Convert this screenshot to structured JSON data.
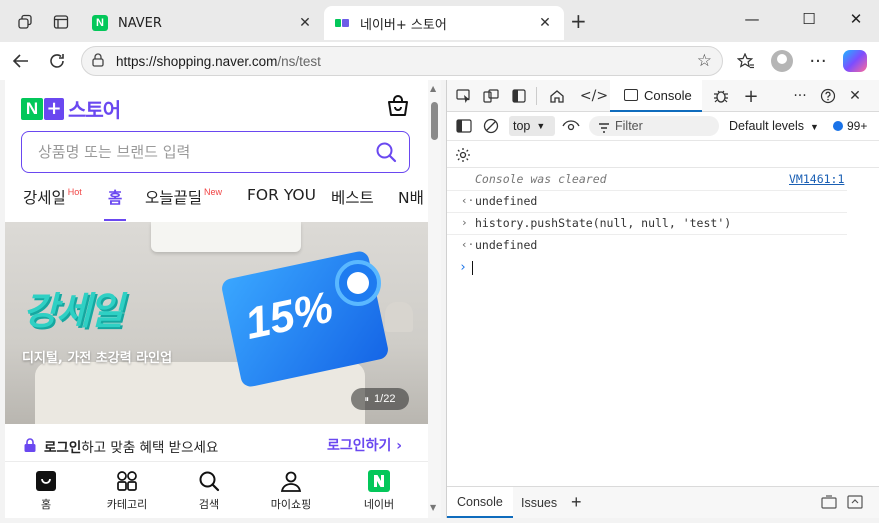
{
  "browser": {
    "tabs": [
      {
        "title": "NAVER",
        "active": false
      },
      {
        "title": "네이버+ 스토어",
        "active": true
      }
    ],
    "new_tab": "+",
    "url_host": "https://shopping.naver.com",
    "url_path": "/ns/test",
    "window_controls": {
      "minimize": "—",
      "maximize": "☐",
      "close": "✕"
    }
  },
  "store": {
    "logo_n": "N",
    "logo_plus": "+",
    "logo_text": "스토어",
    "search_placeholder": "상품명 또는 브랜드 입력",
    "nav": [
      {
        "label": "강세일",
        "badge": "Hot"
      },
      {
        "label": "홈",
        "badge": ""
      },
      {
        "label": "오늘끝딜",
        "badge": "New"
      },
      {
        "label": "FOR YOU",
        "badge": ""
      },
      {
        "label": "베스트",
        "badge": ""
      },
      {
        "label": "N배",
        "badge": ""
      }
    ],
    "banner": {
      "headline": "강세일",
      "subtitle": "디지털, 가전 초강력 라인업",
      "discount": "15%",
      "pager_icon": "⏸",
      "pager": "1/22"
    },
    "login": {
      "message_bold": "로그인",
      "message_rest": "하고 맞춤 혜택 받으세요",
      "cta": "로그인하기 ›"
    },
    "bottom_nav": [
      {
        "label": "홈",
        "icon": "bag-icon"
      },
      {
        "label": "카테고리",
        "icon": "grid-icon"
      },
      {
        "label": "검색",
        "icon": "search-icon"
      },
      {
        "label": "마이쇼핑",
        "icon": "person-icon"
      },
      {
        "label": "네이버",
        "icon": "naver-icon"
      }
    ]
  },
  "devtools": {
    "console_tab": "Console",
    "context": "top",
    "filter_placeholder": "Filter",
    "levels": "Default levels",
    "issues_count": "99+",
    "lines": [
      {
        "arrow": "",
        "text": "Console was cleared",
        "source": "VM1461:1",
        "kind": "info"
      },
      {
        "arrow": "‹·",
        "text": "undefined",
        "source": "",
        "kind": "result"
      },
      {
        "arrow": "›",
        "text": "history.pushState(null, null, 'test')",
        "source": "",
        "kind": "input"
      },
      {
        "arrow": "‹·",
        "text": "undefined",
        "source": "",
        "kind": "result"
      }
    ],
    "prompt": "›",
    "drawer_tabs": [
      "Console",
      "Issues"
    ],
    "drawer_add": "+"
  },
  "colors": {
    "naver_green": "#03c75a",
    "store_purple": "#6a48f0",
    "devtools_accent": "#0f6cbd"
  }
}
